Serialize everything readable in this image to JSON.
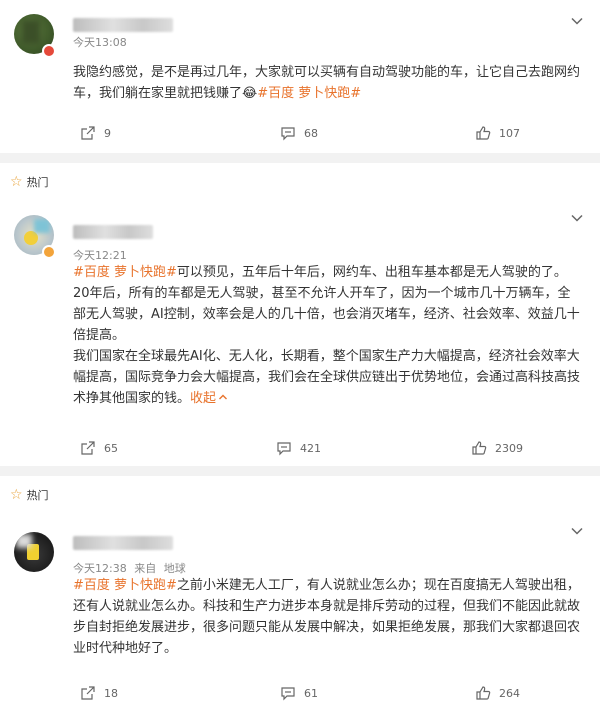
{
  "hot_label": "热门",
  "posts": [
    {
      "time": "今天13:08",
      "source": "",
      "location": "",
      "paragraphs": [
        [
          {
            "t": "我隐约感觉，是不是再过几年，大家就可以买辆有自动驾驶功能的车，让它自己去跑网约车，我们躺在家里就把钱赚了",
            "tag": false
          },
          {
            "t": "😂",
            "tag": false
          },
          {
            "t": "#百度 萝卜快跑#",
            "tag": true
          }
        ]
      ],
      "collapse": "",
      "forwards": "9",
      "comments": "68",
      "likes": "107"
    },
    {
      "time": "今天12:21",
      "source": "",
      "location": "",
      "paragraphs": [
        [
          {
            "t": "#百度 萝卜快跑#",
            "tag": true
          },
          {
            "t": "可以预见，五年后十年后，网约车、出租车基本都是无人驾驶的了。20年后，所有的车都是无人驾驶，甚至不允许人开车了，因为一个城市几十万辆车，全部无人驾驶，AI控制，效率会是人的几十倍，也会消灭堵车，经济、社会效率、效益几十倍提高。",
            "tag": false
          }
        ],
        [
          {
            "t": "我们国家在全球最先AI化、无人化，长期看，整个国家生产力大幅提高，经济社会效率大幅提高，国际竞争力会大幅提高，我们会在全球供应链出于优势地位，会通过高科技高技术挣其他国家的钱。",
            "tag": false
          }
        ]
      ],
      "collapse": "收起",
      "forwards": "65",
      "comments": "421",
      "likes": "2309"
    },
    {
      "time": "今天12:38",
      "source": "来自",
      "location": "地球",
      "paragraphs": [
        [
          {
            "t": "#百度 萝卜快跑#",
            "tag": true
          },
          {
            "t": "之前小米建无人工厂，有人说就业怎么办；现在百度搞无人驾驶出租，还有人说就业怎么办。科技和生产力进步本身就是排斥劳动的过程，但我们不能因此就故步自封拒绝发展进步，很多问题只能从发展中解决，如果拒绝发展，那我们大家都退回农业时代种地好了。",
            "tag": false
          }
        ]
      ],
      "collapse": "",
      "forwards": "18",
      "comments": "61",
      "likes": "264"
    }
  ],
  "icons": {
    "forward": "forward-icon",
    "comment": "comment-icon",
    "like": "thumbs-up-icon",
    "more": "chevron-down-icon",
    "hot": "star-icon",
    "verified": "verified-badge-icon"
  },
  "colors": {
    "topic_tag": "#e8732c",
    "hot_star": "#e8a33a",
    "background": "#f2f2f2"
  }
}
